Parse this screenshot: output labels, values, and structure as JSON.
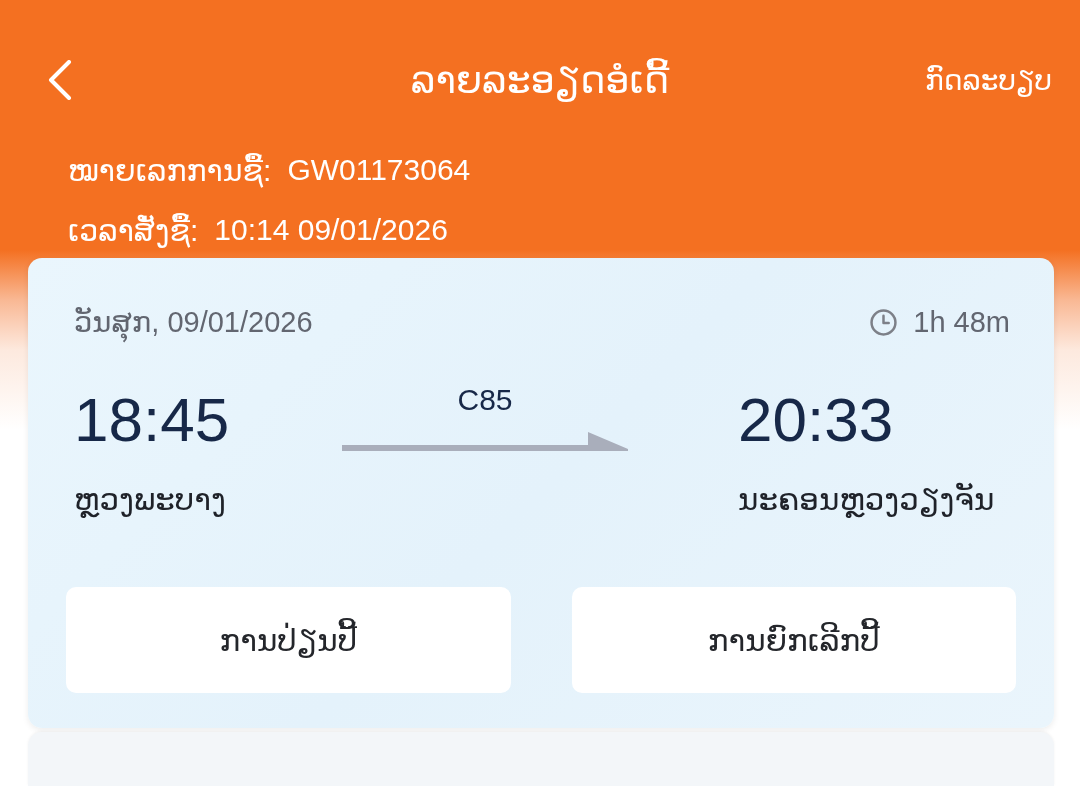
{
  "header": {
    "title": "ລາຍລະອຽດອໍເດີ້",
    "rules_link": "ກົດລະບຽບ"
  },
  "order_info": [
    {
      "label": "ໝາຍເລກການຊື້:",
      "value": "GW01173064"
    },
    {
      "label": "ເວລາສັ່ງຊື້:",
      "value": "10:14 09/01/2026"
    }
  ],
  "trip": {
    "date": "ວັນສຸກ, 09/01/2026",
    "duration": "1h 48m",
    "train": "C85",
    "departure": {
      "time": "18:45",
      "station": "ຫຼວງພະບາງ"
    },
    "arrival": {
      "time": "20:33",
      "station": "ນະຄອນຫຼວງວຽງຈັນ"
    }
  },
  "actions": [
    "ການປ່ຽນປີ້",
    "ການຍົກເລີກປີ້"
  ]
}
